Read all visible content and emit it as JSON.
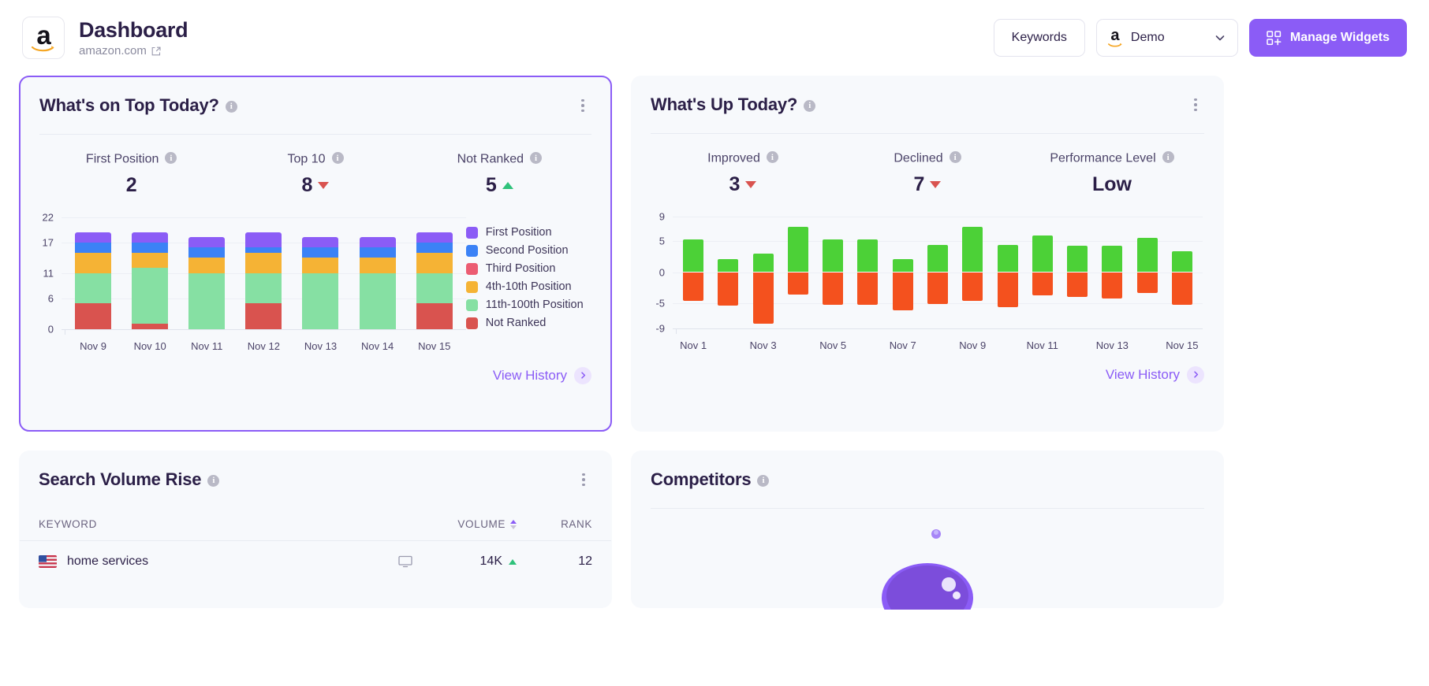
{
  "header": {
    "logo_icon": "amazon-logo-icon",
    "title": "Dashboard",
    "subtitle": "amazon.com",
    "external_link_icon": "external-link-icon",
    "keywords_label": "Keywords",
    "project_name": "Demo",
    "project_icon": "amazon-logo-icon",
    "chevron_icon": "chevron-down-icon",
    "manage_widgets_label": "Manage Widgets",
    "manage_widgets_icon": "widgets-grid-icon",
    "accent_color": "#8b5cf6"
  },
  "widget_top": {
    "title": "What's on Top Today?",
    "info_icon": "info-icon",
    "kebab_icon": "more-options-icon",
    "kpis": [
      {
        "label": "First Position",
        "value": "2",
        "trend": "none"
      },
      {
        "label": "Top 10",
        "value": "8",
        "trend": "down"
      },
      {
        "label": "Not Ranked",
        "value": "5",
        "trend": "up"
      }
    ],
    "view_history_label": "View History",
    "view_history_icon": "chevron-right-icon"
  },
  "widget_up": {
    "title": "What's Up Today?",
    "info_icon": "info-icon",
    "kebab_icon": "more-options-icon",
    "kpis": [
      {
        "label": "Improved",
        "value": "3",
        "trend": "down"
      },
      {
        "label": "Declined",
        "value": "7",
        "trend": "down"
      },
      {
        "label": "Performance Level",
        "value": "Low",
        "trend": "none"
      }
    ],
    "view_history_label": "View History",
    "view_history_icon": "chevron-right-icon"
  },
  "widget_volume": {
    "title": "Search Volume Rise",
    "info_icon": "info-icon",
    "kebab_icon": "more-options-icon",
    "columns": [
      "KEYWORD",
      "VOLUME",
      "RANK"
    ],
    "volume_sort_icon": "sort-icon",
    "rows": [
      {
        "flag": "us-flag-icon",
        "keyword": "home services",
        "device_icon": "desktop-icon",
        "volume": "14K",
        "volume_trend": "up",
        "rank": "12"
      }
    ]
  },
  "widget_competitors": {
    "title": "Competitors",
    "info_icon": "info-icon"
  },
  "chart_data": [
    {
      "type": "bar",
      "stacked": true,
      "title": "What's on Top Today?",
      "xlabel": "",
      "ylabel": "",
      "categories": [
        "Nov 9",
        "Nov 10",
        "Nov 11",
        "Nov 12",
        "Nov 13",
        "Nov 14",
        "Nov 15"
      ],
      "yticks": [
        0,
        6,
        11,
        17,
        22
      ],
      "ylim": [
        0,
        22
      ],
      "grid": true,
      "legend_position": "right",
      "series": [
        {
          "name": "Not Ranked",
          "color": "#d9534f",
          "values": [
            5,
            1,
            0,
            5,
            0,
            0,
            5
          ]
        },
        {
          "name": "11th-100th Position",
          "color": "#86e0a3",
          "values": [
            6,
            11,
            11,
            6,
            11,
            11,
            6
          ]
        },
        {
          "name": "4th-10th Position",
          "color": "#f5b335",
          "values": [
            4,
            3,
            3,
            4,
            3,
            3,
            4
          ]
        },
        {
          "name": "Third Position",
          "color": "#ec5c72",
          "values": [
            0,
            0,
            0,
            0,
            0,
            0,
            0
          ]
        },
        {
          "name": "Second Position",
          "color": "#3b82f6",
          "values": [
            2,
            2,
            2,
            1,
            2,
            2,
            2
          ]
        },
        {
          "name": "First Position",
          "color": "#8b5cf6",
          "values": [
            2,
            2,
            2,
            3,
            2,
            2,
            2
          ]
        }
      ]
    },
    {
      "type": "bar",
      "stacked": false,
      "diverging": true,
      "title": "What's Up Today?",
      "xlabel": "",
      "ylabel": "",
      "x": [
        "Nov 1",
        "Nov 2",
        "Nov 3",
        "Nov 4",
        "Nov 5",
        "Nov 6",
        "Nov 7",
        "Nov 8",
        "Nov 9",
        "Nov 10",
        "Nov 11",
        "Nov 12",
        "Nov 13",
        "Nov 14",
        "Nov 15"
      ],
      "xticks": [
        "Nov 1",
        "Nov 3",
        "Nov 5",
        "Nov 7",
        "Nov 9",
        "Nov 11",
        "Nov 13",
        "Nov 15"
      ],
      "yticks": [
        9,
        5,
        0,
        -5,
        -9
      ],
      "ylim": [
        -9,
        9
      ],
      "grid": true,
      "series": [
        {
          "name": "Improved",
          "color": "#4cd137",
          "values": [
            5.3,
            2.1,
            3.0,
            7.3,
            5.3,
            5.3,
            2.1,
            4.4,
            7.3,
            4.4,
            5.9,
            4.3,
            4.3,
            5.5,
            3.4
          ]
        },
        {
          "name": "Declined",
          "color": "#f4511e",
          "values": [
            -4.6,
            -5.4,
            -8.3,
            -3.6,
            -5.3,
            -5.3,
            -6.1,
            -5.1,
            -4.6,
            -5.6,
            -3.7,
            -4.0,
            -4.3,
            -3.4,
            -5.2
          ]
        }
      ]
    }
  ]
}
